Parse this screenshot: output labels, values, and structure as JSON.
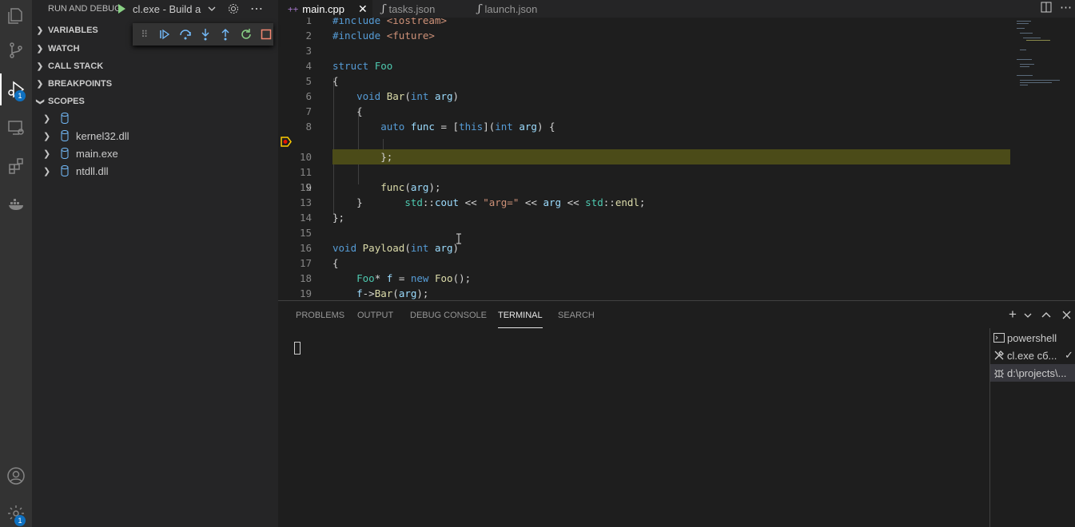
{
  "activity_bar": {
    "debug_badge": "1",
    "settings_badge": "1"
  },
  "sidebar": {
    "title": "RUN AND DEBUG",
    "launch_config": "cl.exe - Build a",
    "sections": {
      "variables": "VARIABLES",
      "watch": "WATCH",
      "call_stack": "CALL STACK",
      "breakpoints": "BREAKPOINTS",
      "scopes": "SCOPES"
    },
    "scope_items": [
      "",
      "kernel32.dll",
      "main.exe",
      "ntdll.dll"
    ]
  },
  "editor": {
    "tabs": [
      {
        "label": "main.cpp",
        "active": true,
        "icon": "cpp-icon"
      },
      {
        "label": "tasks.json",
        "active": false,
        "icon": "json-icon"
      },
      {
        "label": "launch.json",
        "active": false,
        "icon": "json-icon"
      }
    ],
    "lines": [
      {
        "n": "1",
        "text": "#include <iostream>"
      },
      {
        "n": "2",
        "text": "#include <future>"
      },
      {
        "n": "3",
        "text": ""
      },
      {
        "n": "4",
        "text": "struct Foo"
      },
      {
        "n": "5",
        "text": "{"
      },
      {
        "n": "6",
        "text": "    void Bar(int arg)"
      },
      {
        "n": "7",
        "text": "    {"
      },
      {
        "n": "8",
        "text": "        auto func = [this](int arg) {"
      },
      {
        "n": "9",
        "text": "            std::cout << \"arg=\" << arg << std::endl;"
      },
      {
        "n": "10",
        "text": "        };"
      },
      {
        "n": "11",
        "text": ""
      },
      {
        "n": "12",
        "text": "        func(arg);"
      },
      {
        "n": "13",
        "text": "    }"
      },
      {
        "n": "14",
        "text": "};"
      },
      {
        "n": "15",
        "text": ""
      },
      {
        "n": "16",
        "text": "void Payload(int arg)"
      },
      {
        "n": "17",
        "text": "{"
      },
      {
        "n": "18",
        "text": "    Foo* f = new Foo();"
      },
      {
        "n": "19",
        "text": "    f->Bar(arg);"
      }
    ],
    "current_line": "9"
  },
  "panel": {
    "tabs": [
      "PROBLEMS",
      "OUTPUT",
      "DEBUG CONSOLE",
      "TERMINAL",
      "SEARCH"
    ],
    "active_tab": "TERMINAL",
    "terminals": [
      {
        "label": "powershell",
        "icon": "terminal-icon"
      },
      {
        "label": "cl.exe сб...",
        "icon": "tools-icon",
        "status": "✓"
      },
      {
        "label": "d:\\projects\\...",
        "icon": "debug-icon",
        "selected": true
      }
    ]
  },
  "colors": {
    "accent": "#0e70c0",
    "highlight_line": "#4b4b18",
    "breakpoint": "#ffcc00"
  }
}
